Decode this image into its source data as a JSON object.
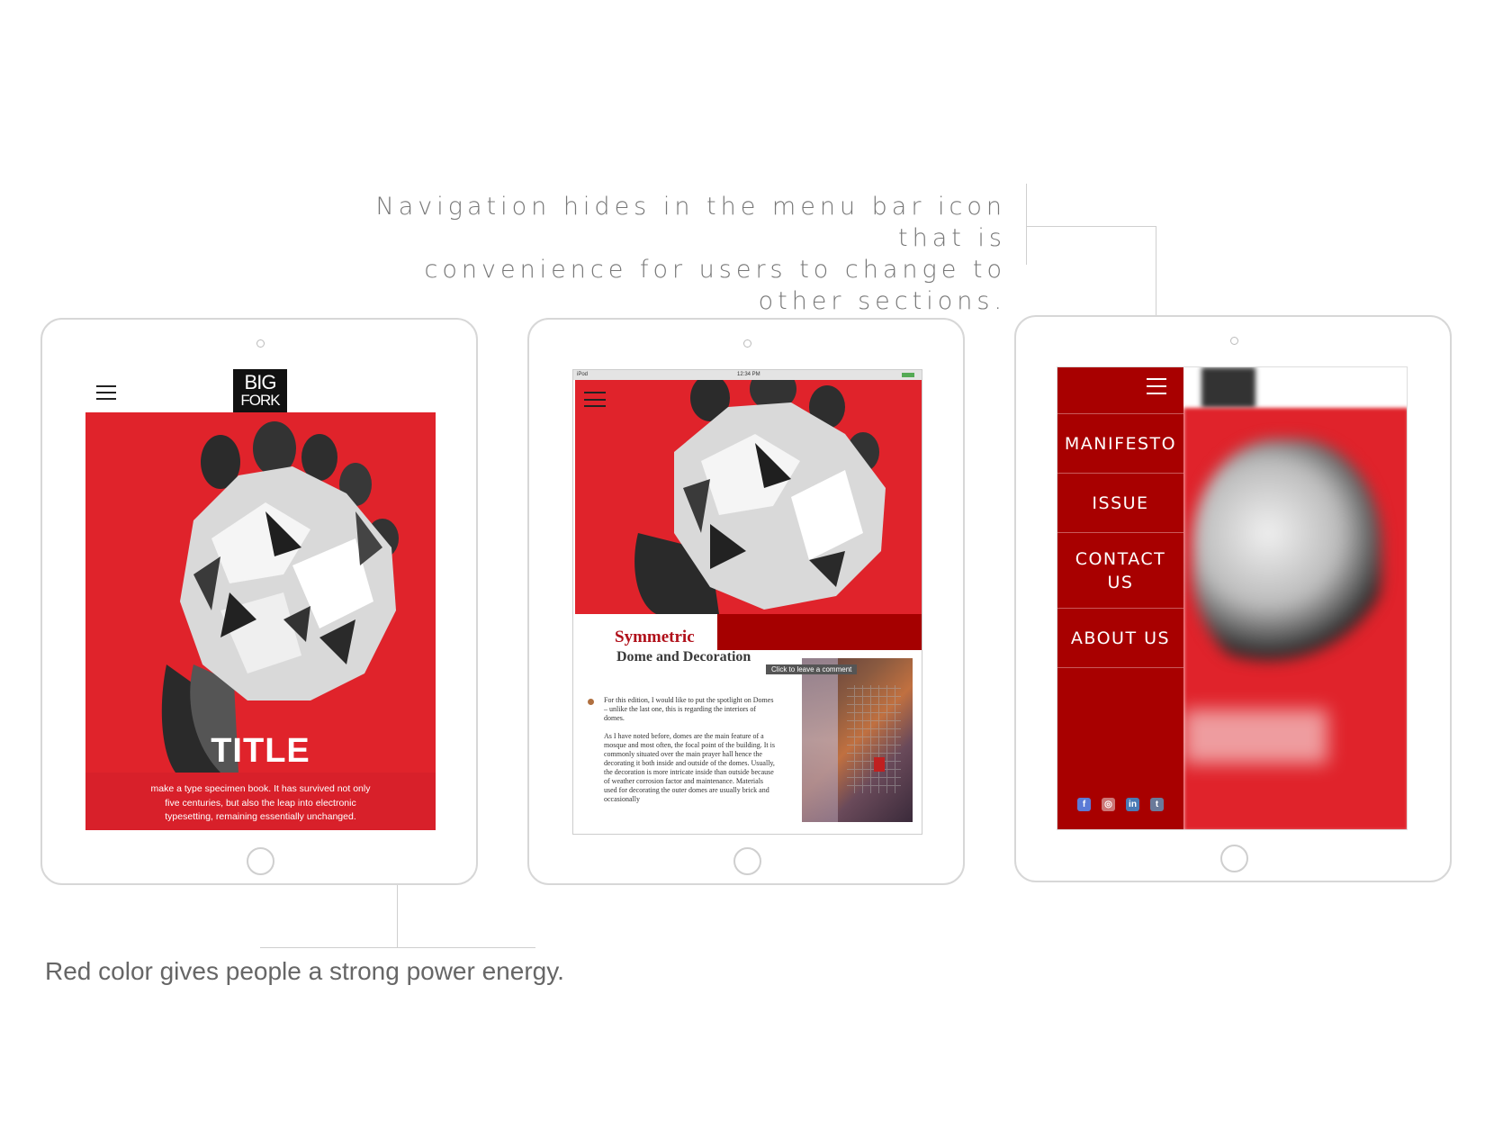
{
  "annotations": {
    "navigation_line1": "Navigation hides in the menu bar icon that is",
    "navigation_line2": "convenience for users to change to other sections.",
    "red_color": "Red color gives people a strong power energy."
  },
  "screen1": {
    "logo_line1": "BIG",
    "logo_line2": "FORK",
    "title": "TITLE",
    "caption_line1": "make a type specimen book. It has survived not only",
    "caption_line2": "five centuries, but also the leap into electronic",
    "caption_line3": "typesetting, remaining essentially unchanged."
  },
  "screen2": {
    "status_left": "iPod",
    "status_time": "12:34 PM",
    "article_title": "Symmetric",
    "article_subtitle": "Dome and Decoration",
    "tooltip": "Click to leave a comment",
    "paragraph1": "For this edition, I would like to put the spotlight on Domes – unlike the last one, this is regarding the interiors of domes.",
    "paragraph2": "As I have noted before, domes are the main feature of a mosque and most often, the focal point of the building. It is commonly situated over the main prayer hall hence the decorating it both inside and outside of the domes. Usually, the decoration is more intricate inside than outside because of weather corrosion factor and maintenance. Materials used for decorating the outer domes are usually brick and occasionally"
  },
  "screen3": {
    "menu": [
      {
        "label": "MANIFESTO"
      },
      {
        "label": "ISSUE"
      },
      {
        "label": "CONTACT US"
      },
      {
        "label": "ABOUT US"
      }
    ],
    "social_icons": [
      "facebook-icon",
      "instagram-icon",
      "linkedin-icon",
      "tumblr-icon"
    ]
  },
  "colors": {
    "red": "#e0232b",
    "dark_red": "#a50000",
    "menu_red": "#a80000"
  }
}
